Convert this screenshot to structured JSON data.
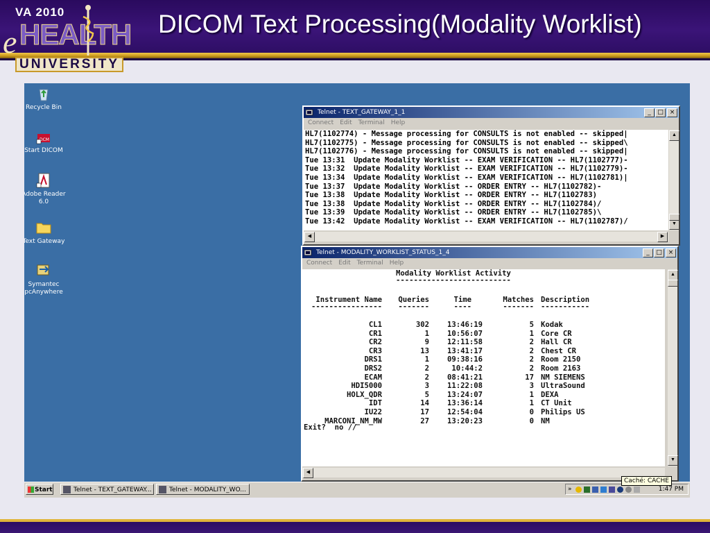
{
  "slide": {
    "title": "DICOM Text Processing(Modality Worklist)",
    "logo": {
      "top": "VA 2010",
      "prefix": "e",
      "main": "HEALTH",
      "bottom": "UNIVERSITY"
    }
  },
  "desktop_icons": [
    {
      "label": "Recycle Bin",
      "icon": "recycle-bin-icon"
    },
    {
      "label": "Start DICOM",
      "icon": "dicom-icon"
    },
    {
      "label": "Adobe Reader 6.0",
      "icon": "adobe-reader-icon"
    },
    {
      "label": "Text Gateway",
      "icon": "folder-icon"
    },
    {
      "label": "Symantec pcAnywhere",
      "icon": "pcanywhere-icon"
    }
  ],
  "gateway_window": {
    "title": "Telnet - TEXT_GATEWAY_1_1",
    "menu": [
      "Connect",
      "Edit",
      "Terminal",
      "Help"
    ],
    "lines": [
      "HL7(1102774) - Message processing for CONSULTS is not enabled -- skipped|",
      "HL7(1102775) - Message processing for CONSULTS is not enabled -- skipped\\",
      "HL7(1102776) - Message processing for CONSULTS is not enabled -- skipped|",
      "Tue 13:31  Update Modality Worklist -- EXAM VERIFICATION -- HL7(1102777)-",
      "Tue 13:32  Update Modality Worklist -- EXAM VERIFICATION -- HL7(1102779)-",
      "Tue 13:34  Update Modality Worklist -- EXAM VERIFICATION -- HL7(1102781)|",
      "Tue 13:37  Update Modality Worklist -- ORDER ENTRY -- HL7(1102782)-",
      "Tue 13:38  Update Modality Worklist -- ORDER ENTRY -- HL7(1102783)",
      "Tue 13:38  Update Modality Worklist -- ORDER ENTRY -- HL7(1102784)/",
      "Tue 13:39  Update Modality Worklist -- ORDER ENTRY -- HL7(1102785)\\",
      "Tue 13:42  Update Modality Worklist -- EXAM VERIFICATION -- HL7(1102787)/"
    ]
  },
  "worklist_window": {
    "title": "Telnet - MODALITY_WORKLIST_STATUS_1_4",
    "menu": [
      "Connect",
      "Edit",
      "Terminal",
      "Help"
    ],
    "heading": "Modality Worklist Activity",
    "heading_rule": "--------------------------",
    "columns": [
      "Instrument Name",
      "Queries",
      "Time",
      "Matches",
      "Description"
    ],
    "column_rules": [
      "----------------",
      "-------",
      "----",
      "-------",
      "-----------"
    ],
    "rows": [
      [
        "CL1",
        "302",
        "13:46:19",
        "5",
        "Kodak"
      ],
      [
        "CR1",
        "1",
        "10:56:07",
        "1",
        "Core CR"
      ],
      [
        "CR2",
        "9",
        "12:11:58",
        "2",
        "Hall CR"
      ],
      [
        "CR3",
        "13",
        "13:41:17",
        "2",
        "Chest CR"
      ],
      [
        "DRS1",
        "1",
        "09:38:16",
        "2",
        "Room 2150"
      ],
      [
        "DRS2",
        "2",
        "10:44:2",
        "2",
        "Room 2163"
      ],
      [
        "ECAM",
        "2",
        "08:41:21",
        "17",
        "NM SIEMENS"
      ],
      [
        "HDI5000",
        "3",
        "11:22:08",
        "3",
        "UltraSound"
      ],
      [
        "HOLX_QDR",
        "5",
        "13:24:07",
        "1",
        "DEXA"
      ],
      [
        "IDT",
        "14",
        "13:36:14",
        "1",
        "CT Unit"
      ],
      [
        "IU22",
        "17",
        "12:54:04",
        "0",
        "Philips US"
      ],
      [
        "MARCONI_NM_MW",
        "27",
        "13:20:23",
        "0",
        "NM"
      ]
    ],
    "prompt": "Exit?  no //"
  },
  "taskbar": {
    "start_label": "Start",
    "items": [
      "Telnet - TEXT_GATEWAY...",
      "Telnet - MODALITY_WO..."
    ],
    "clock": "1:47 PM",
    "tooltip": "Caché: CACHE",
    "tray_expand": "»"
  }
}
